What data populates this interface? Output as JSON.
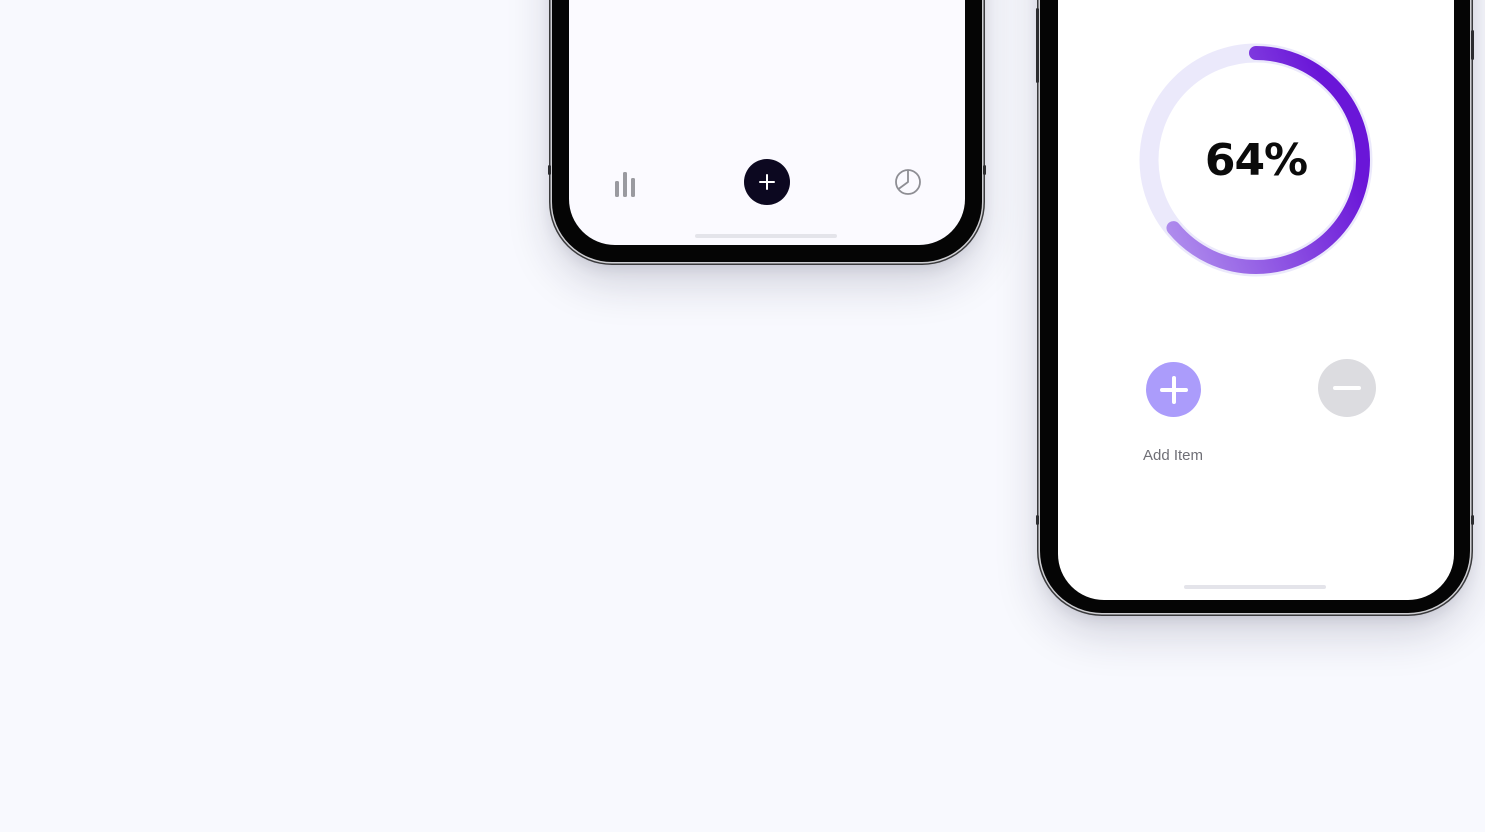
{
  "colors": {
    "background": "#f8f9fe",
    "phone_frame": "#050505",
    "tabbar_add_button": "#0c0820",
    "tabbar_icon": "#9a9aa0",
    "progress_track": "#ebe9fb",
    "progress_start": "#b99ef0",
    "progress_end": "#6a16d8",
    "add_button": "#ab9cfb",
    "remove_button": "#dcdce0",
    "label_text": "#6f6f76"
  },
  "tabbar": {
    "items": [
      {
        "icon": "bar-chart-icon"
      },
      {
        "icon": "plus-icon"
      },
      {
        "icon": "pie-chart-icon"
      }
    ]
  },
  "progress": {
    "value_text": "64%",
    "fraction": 0.64
  },
  "actions": {
    "add_icon": "plus-icon",
    "remove_icon": "minus-icon",
    "add_label": "Add Item"
  }
}
